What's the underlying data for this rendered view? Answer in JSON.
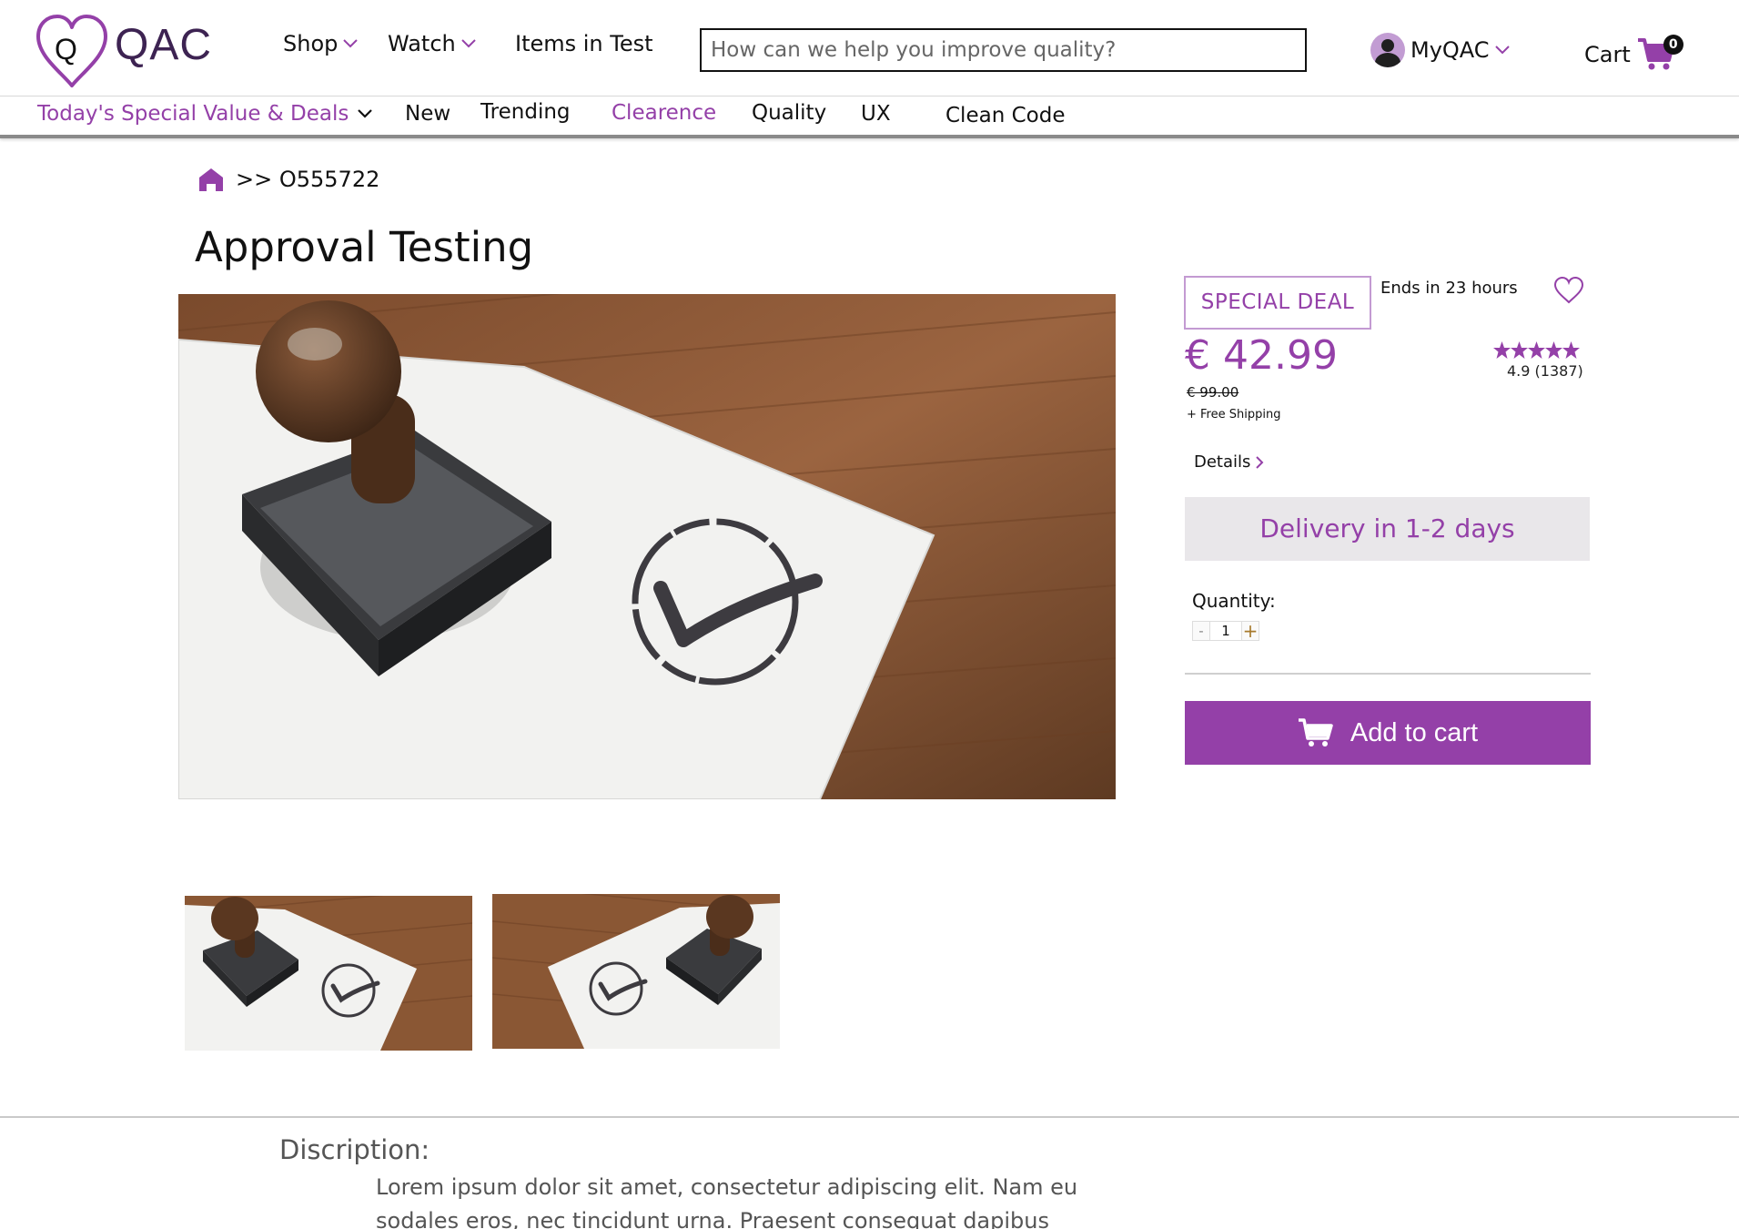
{
  "brand": {
    "name": "QAC",
    "heart_letter": "Q"
  },
  "header": {
    "nav": [
      {
        "label": "Shop",
        "has_dropdown": true
      },
      {
        "label": "Watch",
        "has_dropdown": true
      },
      {
        "label": "Items in Test",
        "has_dropdown": false
      }
    ],
    "search_placeholder": "How can we help you improve quality?",
    "account_label": "MyQAC",
    "cart_label": "Cart",
    "cart_count": "0"
  },
  "subnav": [
    {
      "label": "Today's Special Value & Deals",
      "highlight": true,
      "has_dropdown": true
    },
    {
      "label": "New",
      "highlight": false
    },
    {
      "label": "Trending",
      "highlight": false
    },
    {
      "label": "Clearence",
      "highlight": true
    },
    {
      "label": "Quality",
      "highlight": false
    },
    {
      "label": "UX",
      "highlight": false
    },
    {
      "label": "Clean Code",
      "highlight": false
    }
  ],
  "breadcrumb": {
    "path": ">> O555722"
  },
  "product": {
    "title": "Approval Testing",
    "deal_label": "SPECIAL DEAL",
    "ends_in": "Ends in 23 hours",
    "price": "€ 42.99",
    "old_price": "€ 99.00",
    "shipping": "+ Free Shipping",
    "rating_value": 4.9,
    "rating_text": "4.9 (1387)",
    "details_label": "Details",
    "delivery": "Delivery in 1-2 days",
    "quantity_label": "Quantity:",
    "quantity": "1",
    "qty_minus": "-",
    "qty_plus": "+",
    "add_to_cart": "Add to cart"
  },
  "description": {
    "heading": "Discription:",
    "text": "Lorem ipsum dolor sit amet, consectetur adipiscing elit. Nam eu sodales eros, nec tincidunt urna. Praesent consequat dapibus"
  },
  "colors": {
    "accent": "#9440a8",
    "brand_dark": "#3d2352",
    "delivery_bg": "#e9e7ea"
  },
  "icons": [
    "heart-logo-icon",
    "chevron-down-icon",
    "avatar-icon",
    "cart-icon",
    "home-icon",
    "wishlist-heart-icon",
    "star-icon",
    "chevron-right-icon"
  ]
}
